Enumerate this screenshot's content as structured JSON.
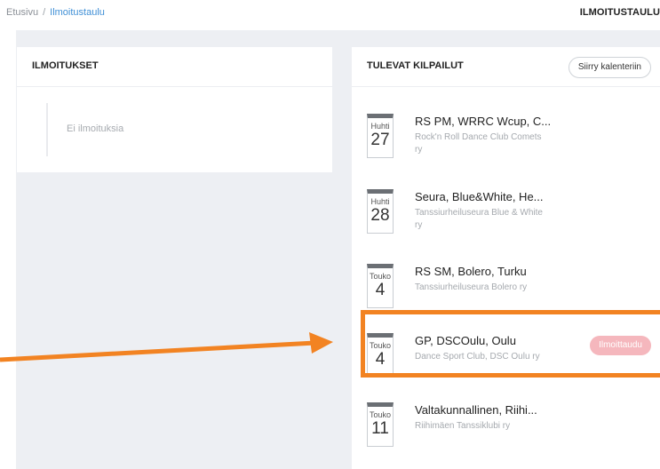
{
  "breadcrumb": {
    "home": "Etusivu",
    "separator": "/",
    "current": "Ilmoitustaulu"
  },
  "page_title": "ILMOITUSTAULU",
  "announcements": {
    "title": "ILMOITUKSET",
    "empty_text": "Ei ilmoituksia"
  },
  "competitions": {
    "title": "TULEVAT KILPAILUT",
    "calendar_button": "Siirry kalenteriin",
    "events": [
      {
        "month": "Huhti",
        "day": "27",
        "title": "RS PM, WRRC Wcup, C...",
        "organizer": "Rock'n Roll Dance Club Comets ry",
        "signup": ""
      },
      {
        "month": "Huhti",
        "day": "28",
        "title": "Seura, Blue&White, He...",
        "organizer": "Tanssiurheiluseura Blue & White ry",
        "signup": ""
      },
      {
        "month": "Touko",
        "day": "4",
        "title": "RS SM, Bolero, Turku",
        "organizer": "Tanssiurheiluseura Bolero ry",
        "signup": ""
      },
      {
        "month": "Touko",
        "day": "4",
        "title": "GP, DSCOulu, Oulu",
        "organizer": "Dance Sport Club, DSC Oulu ry",
        "signup": "Ilmoittaudu"
      },
      {
        "month": "Touko",
        "day": "11",
        "title": "Valtakunnallinen, Riihi...",
        "organizer": "Riihimäen Tanssiklubi ry",
        "signup": ""
      }
    ]
  },
  "colors": {
    "accent_link": "#3f8fd6",
    "annotation_orange": "#f28322",
    "signup_badge": "#f5b7bd",
    "background_gray": "#edeff3"
  }
}
